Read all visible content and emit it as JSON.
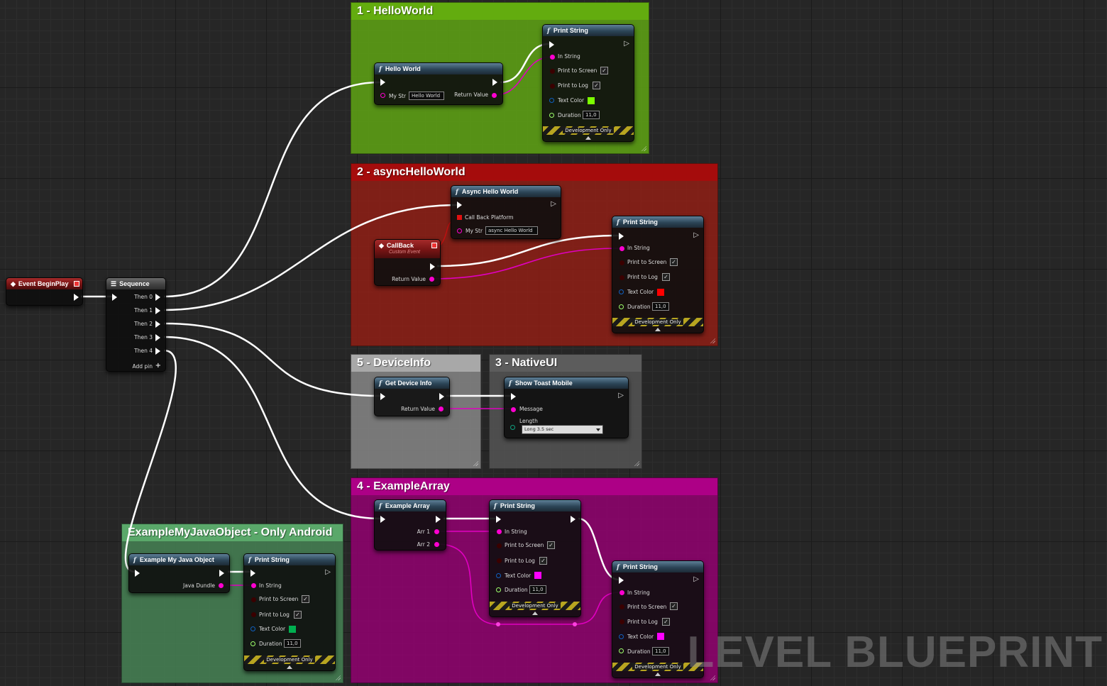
{
  "colors": {
    "exec": "#ffffff",
    "string_pin": "#ff00d0",
    "bool_pin": "#8b0000",
    "struct_pin": "#0070c0",
    "float_pin": "#9dff6b",
    "comment_green": "#5b9f1a",
    "comment_red": "#a11010",
    "comment_gray_light": "#8c8c8c",
    "comment_gray_dark": "#5a5a5a",
    "comment_magenta": "#a8007f",
    "comment_android": "#4a8a5a"
  },
  "comments": {
    "hello": "1 - HelloWorld",
    "async": "2 - asyncHelloWorld",
    "device": "5 - DeviceInfo",
    "native": "3 - NativeUI",
    "array": "4 - ExampleArray",
    "android": "ExampleMyJavaObject - Only Android"
  },
  "event_beginplay": {
    "title": "Event BeginPlay"
  },
  "sequence": {
    "title": "Sequence",
    "outputs": [
      "Then 0",
      "Then 1",
      "Then 2",
      "Then 3",
      "Then 4"
    ],
    "add_pin": "Add pin"
  },
  "hello_world": {
    "title": "Hello World",
    "my_str_label": "My Str",
    "my_str_value": "Hello World",
    "return_label": "Return Value"
  },
  "print_string": {
    "title": "Print String",
    "in_string": "In String",
    "print_to_screen": "Print to Screen",
    "print_to_log": "Print to Log",
    "text_color": "Text Color",
    "duration": "Duration",
    "duration_value": "11,0",
    "dev_only": "Development Only",
    "check": "✓"
  },
  "print_colors": {
    "hello": "#7cff00",
    "async": "#ff0000",
    "array_a": "#ff00ff",
    "array_b": "#ff00ff",
    "android": "#00b050"
  },
  "async_hello": {
    "title": "Async Hello World",
    "callback_platform": "Call Back Platform",
    "my_str_label": "My Str",
    "my_str_value": "async Hello World"
  },
  "callback": {
    "title": "CallBack",
    "subtitle": "Custom Event",
    "return_label": "Return Value"
  },
  "device_info": {
    "title": "Get Device Info",
    "return_label": "Return Value"
  },
  "toast": {
    "title": "Show Toast Mobile",
    "message": "Message",
    "length_label": "Length",
    "length_value": "Long 3.5 sec"
  },
  "example_array": {
    "title": "Example Array",
    "arr1": "Arr 1",
    "arr2": "Arr 2"
  },
  "java_object": {
    "title": "Example My Java Object",
    "return_label": "Java Dundle"
  },
  "watermark": "LEVEL BLUEPRINT"
}
